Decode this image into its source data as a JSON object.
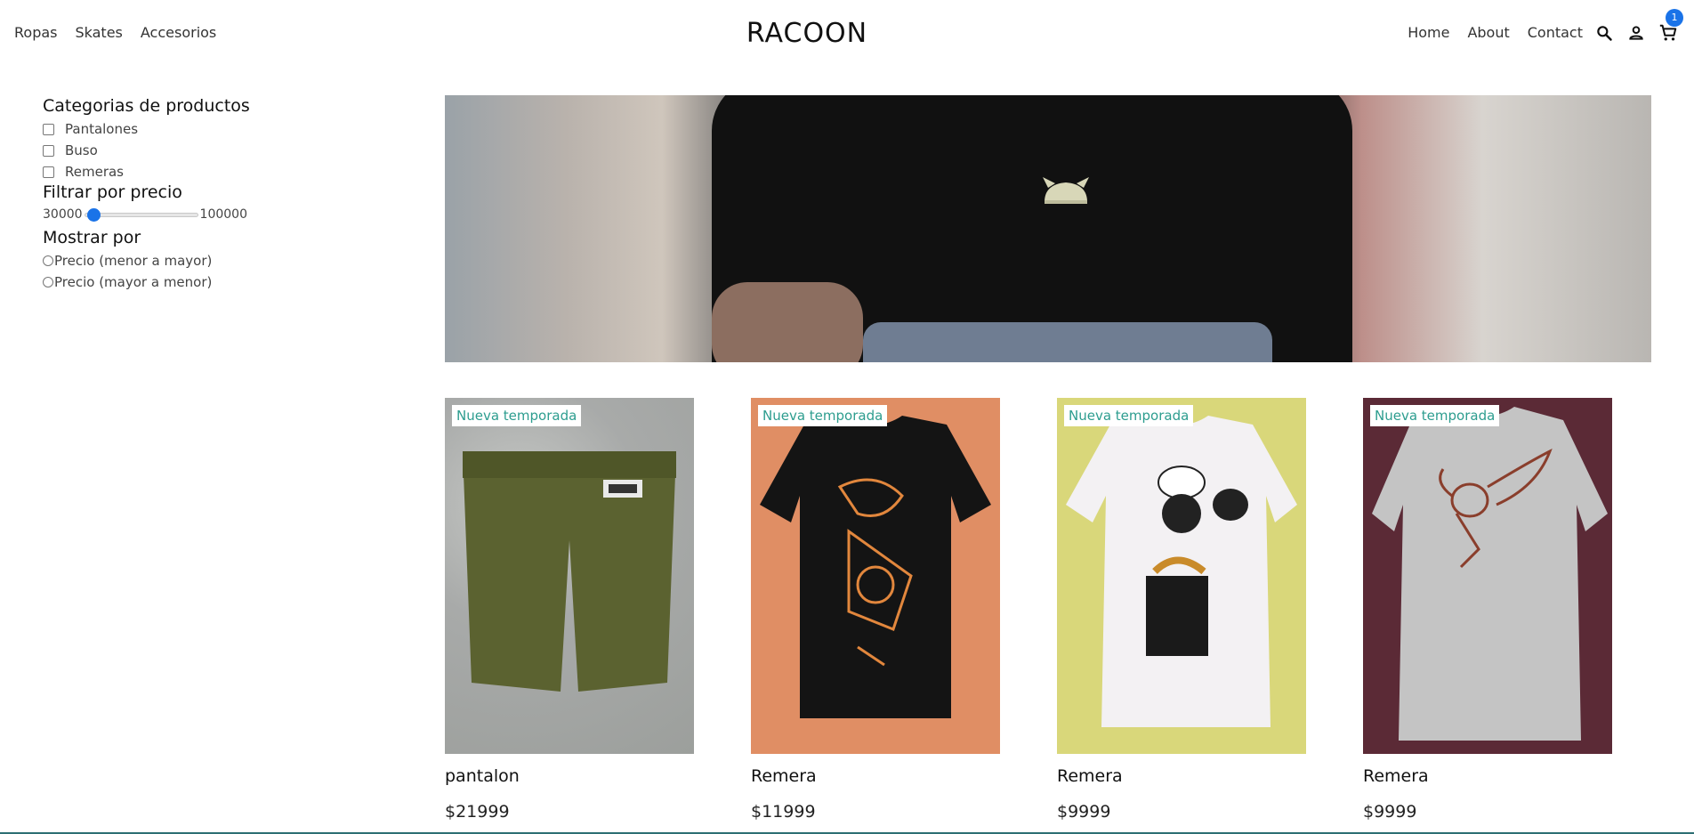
{
  "header": {
    "nav_left": [
      "Ropas",
      "Skates",
      "Accesorios"
    ],
    "brand": "RACOON",
    "nav_right": [
      "Home",
      "About",
      "Contact"
    ],
    "cart_count": "1",
    "icons": [
      "search-icon",
      "user-icon",
      "cart-icon"
    ]
  },
  "filters": {
    "categories_title": "Categorias de productos",
    "categories": [
      "Pantalones",
      "Buso",
      "Remeras"
    ],
    "price_title": "Filtrar por precio",
    "price_min": "30000",
    "price_max": "100000",
    "price_value_fraction": 0.0,
    "sort_title": "Mostrar por",
    "sort_options": [
      "Precio (menor a mayor)",
      "Precio (mayor a menor)"
    ]
  },
  "products": [
    {
      "tag": "Nueva temporada",
      "name": "pantalon",
      "price": "$21999"
    },
    {
      "tag": "Nueva temporada",
      "name": "Remera",
      "price": "$11999"
    },
    {
      "tag": "Nueva temporada",
      "name": "Remera",
      "price": "$9999"
    },
    {
      "tag": "Nueva temporada",
      "name": "Remera",
      "price": "$9999"
    }
  ],
  "colors": {
    "accent": "#1a73e8",
    "tag_text": "#2d9d8f"
  }
}
